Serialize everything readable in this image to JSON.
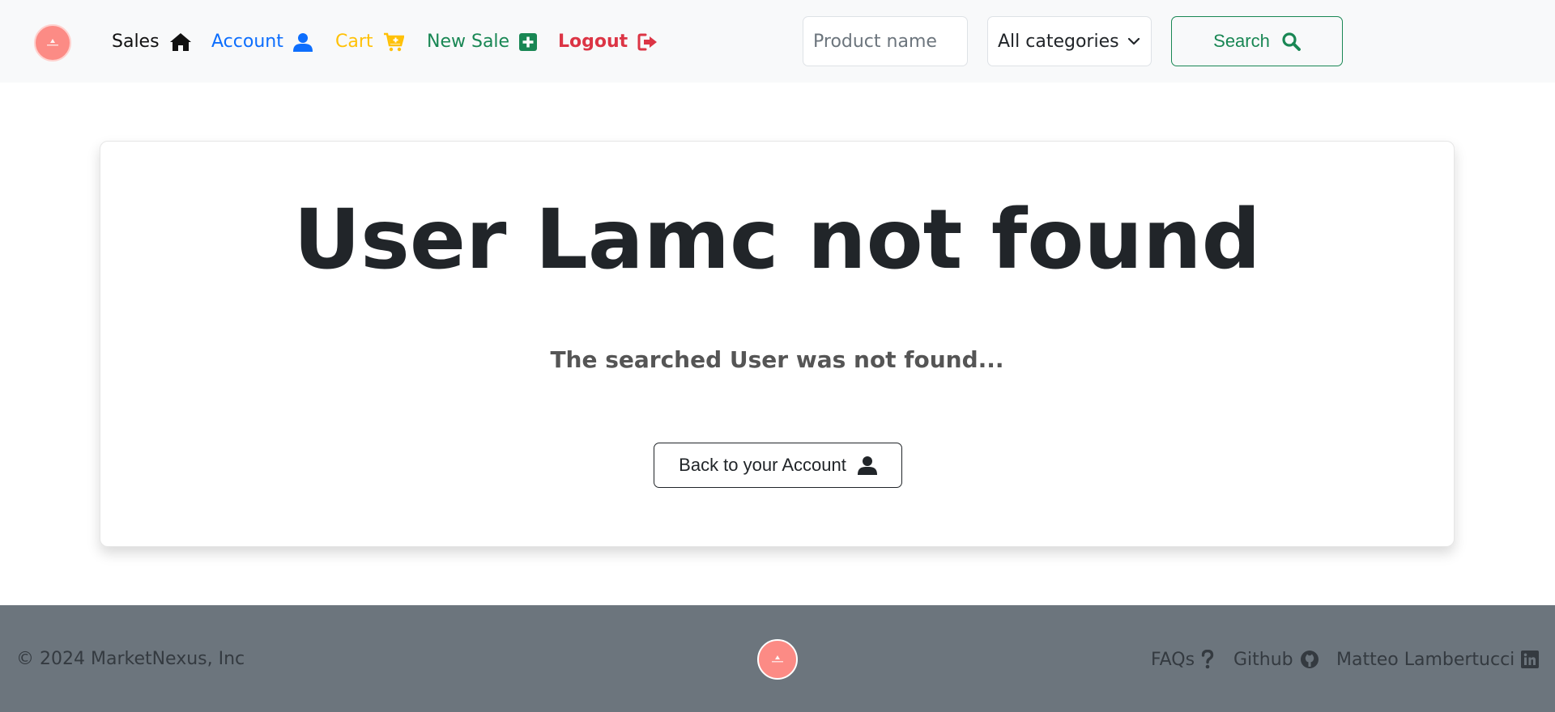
{
  "navbar": {
    "logo_icon": "marketnexus-logo",
    "links": [
      {
        "label": "Sales",
        "icon": "home-icon",
        "color": "#111111"
      },
      {
        "label": "Account",
        "icon": "user-icon",
        "color": "#0d6efd"
      },
      {
        "label": "Cart",
        "icon": "cart-plus-icon",
        "color": "#ffc107"
      },
      {
        "label": "New Sale",
        "icon": "plus-square-icon",
        "color": "#198754"
      },
      {
        "label": "Logout",
        "icon": "logout-icon",
        "color": "#dc3545"
      }
    ],
    "search": {
      "placeholder": "Product name",
      "value": "",
      "category_selected": "All categories",
      "button_label": "Search",
      "button_color": "#198754"
    }
  },
  "main": {
    "title": "User Lamc not found",
    "subtitle": "The searched User was not found...",
    "back_button_label": "Back to your Account"
  },
  "footer": {
    "copyright": "© 2024 MarketNexus, Inc",
    "links": [
      {
        "label": "FAQs",
        "icon": "question-icon"
      },
      {
        "label": "Github",
        "icon": "github-icon"
      },
      {
        "label": "Matteo Lambertucci",
        "icon": "linkedin-icon"
      }
    ],
    "background_color": "#6c757d"
  },
  "colors": {
    "brand_logo": "#fc8b85",
    "navbar_bg": "#f8f9fa",
    "text_dark": "#212529"
  }
}
